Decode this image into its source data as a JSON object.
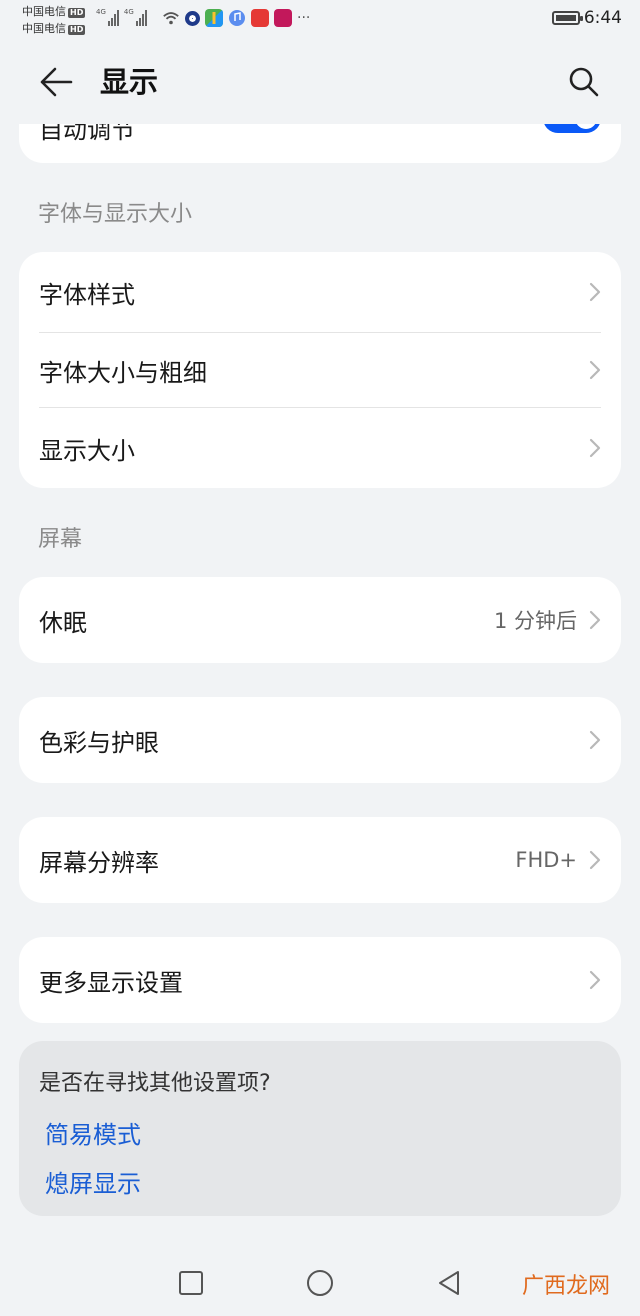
{
  "status_bar": {
    "carrier_1": "中国电信",
    "carrier_2": "中国电信",
    "hd_badge": "HD",
    "network_type": "4G",
    "time": "6:44",
    "more": "···"
  },
  "header": {
    "title": "显示",
    "back_icon": "arrow-left-icon",
    "search_icon": "search-icon"
  },
  "top_card": {
    "label": "自动调节",
    "toggle_on": true
  },
  "font_section": {
    "title": "字体与显示大小",
    "items": [
      {
        "label": "字体样式"
      },
      {
        "label": "字体大小与粗细"
      },
      {
        "label": "显示大小"
      }
    ]
  },
  "screen_section": {
    "title": "屏幕",
    "sleep": {
      "label": "休眠",
      "value": "1 分钟后"
    }
  },
  "color_card": {
    "label": "色彩与护眼"
  },
  "resolution_card": {
    "label": "屏幕分辨率",
    "value": "FHD+"
  },
  "more_card": {
    "label": "更多显示设置"
  },
  "suggestions": {
    "question": "是否在寻找其他设置项?",
    "links": [
      "简易模式",
      "熄屏显示"
    ]
  },
  "watermark": "广西龙网",
  "colors": {
    "background": "#f1f3f5",
    "card": "#ffffff",
    "accent": "#0a59f7",
    "link": "#1a5ed4"
  }
}
